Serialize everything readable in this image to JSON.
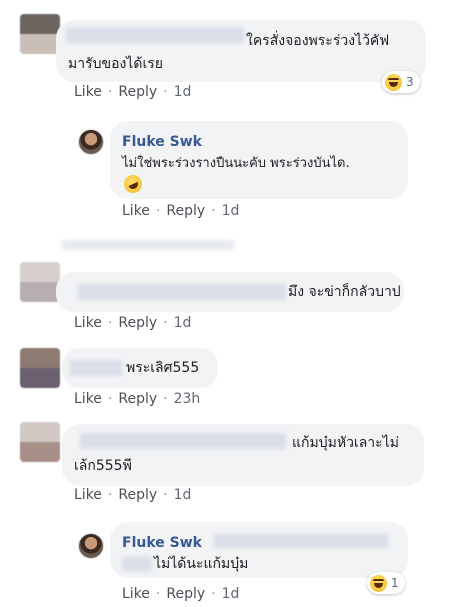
{
  "colors": {
    "bubble": "#f2f3f5",
    "name": "#385898",
    "action": "#4b4f56",
    "meta": "#606770"
  },
  "comments": [
    {
      "text_line1": "ใครสั่งจองพระร่วงไว้คัฟ",
      "text_line2": "มารับของได้เรย",
      "reaction_icon": "laugh-emoji-icon",
      "reaction_count": "3",
      "like": "Like",
      "reply": "Reply",
      "time": "1d",
      "replies": [
        {
          "author": "Fluke Swk",
          "text": "ไม่ใช่พระร่วงรางปืนนะคับ พระร่วงบันได.",
          "emoji": "rofl-emoji-icon",
          "like": "Like",
          "reply": "Reply",
          "time": "1d"
        }
      ]
    },
    {
      "text": "มึง จะข่าก็กลัวบาป",
      "like": "Like",
      "reply": "Reply",
      "time": "1d"
    },
    {
      "text": "พระเลิศ555",
      "like": "Like",
      "reply": "Reply",
      "time": "23h"
    },
    {
      "text_line1": "แก้มบุ๋มหัวเลาะไม่",
      "text_line2": "เล้ก555พี",
      "like": "Like",
      "reply": "Reply",
      "time": "1d",
      "replies": [
        {
          "author": "Fluke Swk",
          "text": "ไม่ได้นะแก้มบุ๋ม",
          "reaction_icon": "laugh-emoji-icon",
          "reaction_count": "1",
          "like": "Like",
          "reply": "Reply",
          "time": "1d"
        }
      ]
    }
  ]
}
